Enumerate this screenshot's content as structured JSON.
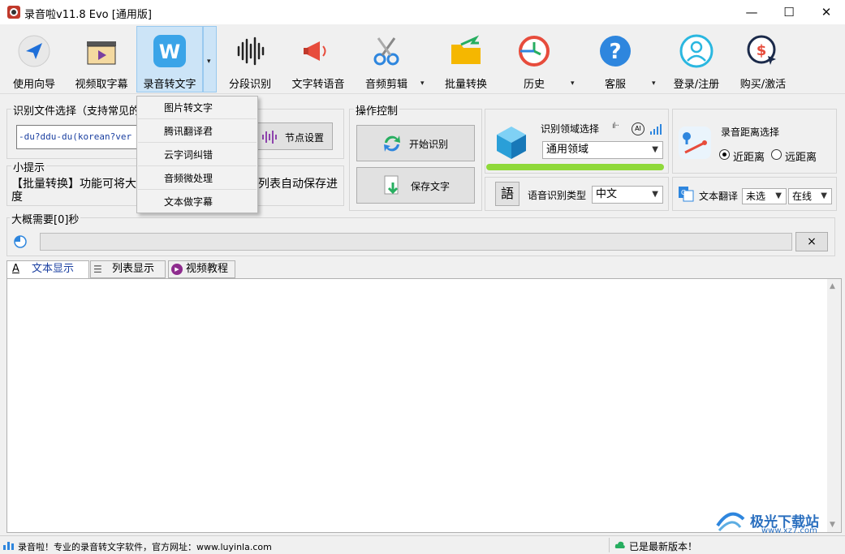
{
  "window": {
    "title": "录音啦v11.8 Evo [通用版]",
    "min": "—",
    "max": "☐",
    "close": "✕"
  },
  "toolbar": {
    "guide": "使用向导",
    "video_subtitle": "视频取字幕",
    "audio_to_text": "录音转文字",
    "segment": "分段识别",
    "tts": "文字转语音",
    "audio_edit": "音频剪辑",
    "batch": "批量转换",
    "history": "历史",
    "service": "客服",
    "login": "登录/注册",
    "buy": "购买/激活",
    "dropdown_arrow": "▾"
  },
  "menu": {
    "items": [
      "图片转文字",
      "腾讯翻译君",
      "云字词纠错",
      "音频微处理",
      "文本做字幕"
    ]
  },
  "file_panel": {
    "legend": "识别文件选择（支持常见的音",
    "path": "-du?ddu-du(korean?ver",
    "node_btn": "节点设置"
  },
  "tips": {
    "legend": "小提示",
    "text_left": "【批量转换】功能可将大",
    "text_right": "列表自动保存进",
    "text_line2": "度"
  },
  "control": {
    "legend": "操作控制",
    "start": "开始识别",
    "save": "保存文字"
  },
  "domain": {
    "label": "识别领域选择",
    "value": "通用领域",
    "ai": "AI"
  },
  "distance": {
    "label": "录音距离选择",
    "near": "近距离",
    "far": "远距离"
  },
  "lang": {
    "icon": "語",
    "label": "语音识别类型",
    "value": "中文"
  },
  "translate": {
    "label": "文本翻译",
    "value1": "未选",
    "value2": "在线"
  },
  "progress": {
    "legend": "大概需要[0]秒",
    "fraction": 0,
    "clear": "×"
  },
  "tabs": [
    "文本显示",
    "列表显示",
    "视频教程"
  ],
  "status": {
    "left": "录音啦！专业的录音转文字软件，官方网址：www.luyinla.com",
    "right": "已是最新版本！"
  },
  "watermark": {
    "text": "极光下载站",
    "url": "www.xz7.com"
  },
  "colors": {
    "accent": "#1e88e5",
    "green": "#7ed321",
    "active_bg": "#cce4f7"
  }
}
